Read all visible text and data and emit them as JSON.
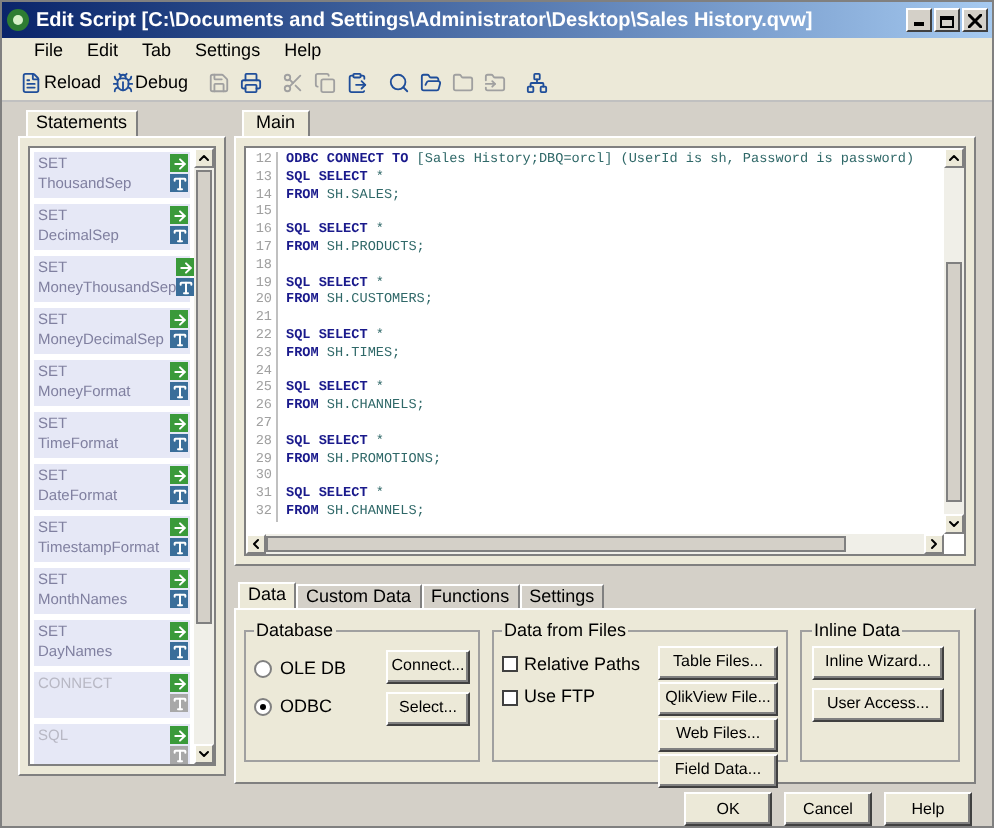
{
  "window": {
    "title": "Edit Script [C:\\Documents and Settings\\Administrator\\Desktop\\Sales History.qvw]"
  },
  "menu": [
    "File",
    "Edit",
    "Tab",
    "Settings",
    "Help"
  ],
  "toolbar": [
    {
      "label": "Reload",
      "disabled": false
    },
    {
      "label": "Debug",
      "disabled": false
    },
    {
      "disabled": true
    },
    {
      "disabled": false
    },
    {
      "disabled": true
    },
    {
      "disabled": true
    },
    {
      "disabled": false
    },
    {
      "disabled": false
    },
    {
      "disabled": false
    },
    {
      "disabled": true
    },
    {
      "disabled": true
    },
    {
      "disabled": false
    }
  ],
  "statements": {
    "tab": "Statements",
    "items": [
      {
        "keyword": "SET",
        "name": "ThousandSep",
        "disabled": false
      },
      {
        "keyword": "SET",
        "name": "DecimalSep",
        "disabled": false
      },
      {
        "keyword": "SET",
        "name": "MoneyThousandSep",
        "disabled": false
      },
      {
        "keyword": "SET",
        "name": "MoneyDecimalSep",
        "disabled": false
      },
      {
        "keyword": "SET",
        "name": "MoneyFormat",
        "disabled": false
      },
      {
        "keyword": "SET",
        "name": "TimeFormat",
        "disabled": false
      },
      {
        "keyword": "SET",
        "name": "DateFormat",
        "disabled": false
      },
      {
        "keyword": "SET",
        "name": "TimestampFormat",
        "disabled": false
      },
      {
        "keyword": "SET",
        "name": "MonthNames",
        "disabled": false
      },
      {
        "keyword": "SET",
        "name": "DayNames",
        "disabled": false
      },
      {
        "keyword": "CONNECT",
        "disabled": true
      },
      {
        "keyword": "SQL",
        "disabled": true
      }
    ]
  },
  "script_tabs": [
    {
      "label": "Main",
      "selected": true
    }
  ],
  "code": [
    {
      "number": "12",
      "keyword": "ODBC CONNECT TO",
      "rest": "[Sales History;DBQ=orcl] (UserId is sh, Password is password)"
    },
    {
      "number": "13",
      "keyword": "SQL SELECT",
      "rest": "*"
    },
    {
      "number": "14",
      "keyword": "FROM",
      "rest": "SH.SALES;"
    },
    {
      "number": "15"
    },
    {
      "number": "16",
      "keyword": "SQL SELECT",
      "rest": "*"
    },
    {
      "number": "17",
      "keyword": "FROM",
      "rest": "SH.PRODUCTS;"
    },
    {
      "number": "18"
    },
    {
      "number": "19",
      "keyword": "SQL SELECT",
      "rest": "*"
    },
    {
      "number": "20",
      "keyword": "FROM",
      "rest": "SH.CUSTOMERS;"
    },
    {
      "number": "21"
    },
    {
      "number": "22",
      "keyword": "SQL SELECT",
      "rest": "*"
    },
    {
      "number": "23",
      "keyword": "FROM",
      "rest": "SH.TIMES;"
    },
    {
      "number": "24"
    },
    {
      "number": "25",
      "keyword": "SQL SELECT",
      "rest": "*"
    },
    {
      "number": "26",
      "keyword": "FROM",
      "rest": "SH.CHANNELS;"
    },
    {
      "number": "27"
    },
    {
      "number": "28",
      "keyword": "SQL SELECT",
      "rest": "*"
    },
    {
      "number": "29",
      "keyword": "FROM",
      "rest": "SH.PROMOTIONS;"
    },
    {
      "number": "30"
    },
    {
      "number": "31",
      "keyword": "SQL SELECT",
      "rest": "*"
    },
    {
      "number": "32",
      "keyword": "FROM",
      "rest": "SH.CHANNELS;"
    }
  ],
  "bottom_tabs": [
    {
      "label": "Data",
      "selected": true
    },
    {
      "label": "Custom Data",
      "selected": false
    },
    {
      "label": "Functions",
      "selected": false
    },
    {
      "label": "Settings",
      "selected": false
    }
  ],
  "database": {
    "title": "Database",
    "radios": [
      {
        "label": "OLE DB",
        "selected": false
      },
      {
        "label": "ODBC",
        "selected": true
      }
    ],
    "buttons": [
      "Connect...",
      "Select..."
    ]
  },
  "data_from_files": {
    "title": "Data from Files",
    "checkboxes": [
      {
        "label": "Relative Paths",
        "checked": false
      },
      {
        "label": "Use FTP",
        "checked": false
      }
    ],
    "buttons": [
      "Table Files...",
      "QlikView File...",
      "Web Files...",
      "Field Data..."
    ]
  },
  "inline_data": {
    "title": "Inline Data",
    "buttons": [
      "Inline Wizard...",
      "User Access..."
    ]
  },
  "dialog_buttons": [
    "OK",
    "Cancel",
    "Help"
  ]
}
